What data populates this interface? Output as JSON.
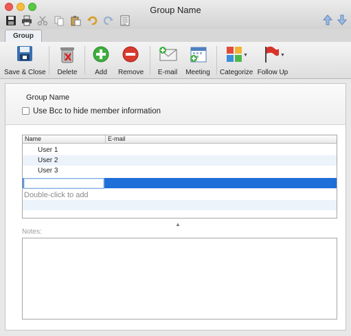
{
  "window": {
    "title": "Group Name"
  },
  "tabs": [
    {
      "label": "Group"
    }
  ],
  "ribbon": {
    "save_close": "Save & Close",
    "delete": "Delete",
    "add": "Add",
    "remove": "Remove",
    "email": "E-mail",
    "meeting": "Meeting",
    "categorize": "Categorize",
    "follow_up": "Follow Up"
  },
  "form": {
    "group_name": "Group Name",
    "bcc_label": "Use Bcc to hide member information",
    "bcc_checked": false
  },
  "table": {
    "columns": [
      "Name",
      "E-mail"
    ],
    "rows": [
      {
        "name": "User 1",
        "email": ""
      },
      {
        "name": "User 2",
        "email": ""
      },
      {
        "name": "User 3",
        "email": ""
      }
    ],
    "add_hint": "Double-click to add"
  },
  "notes": {
    "label": "Notes:",
    "value": ""
  },
  "colors": {
    "selection": "#1e6fd8",
    "row_alt": "#edf3fb",
    "add_green": "#3fae3f",
    "remove_red": "#d93a2e"
  }
}
